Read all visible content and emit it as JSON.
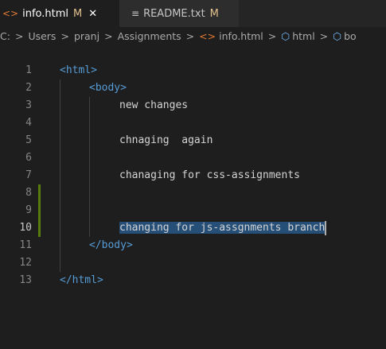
{
  "tabs": [
    {
      "name": "info.html",
      "status": "M",
      "close": "✕",
      "icon": "html-icon",
      "active": true
    },
    {
      "name": "README.txt",
      "status": "M",
      "icon": "text-lines-icon",
      "active": false
    }
  ],
  "breadcrumb": {
    "items": [
      "C:",
      "Users",
      "pranj",
      "Assignments",
      "info.html",
      "html",
      "bo"
    ],
    "separator": ">"
  },
  "editor": {
    "lines": [
      {
        "num": "1",
        "text": "<html>"
      },
      {
        "num": "2",
        "text": "<body>"
      },
      {
        "num": "3",
        "text": "new changes"
      },
      {
        "num": "4",
        "text": ""
      },
      {
        "num": "5",
        "text": "chnaging  again"
      },
      {
        "num": "6",
        "text": ""
      },
      {
        "num": "7",
        "text": "chanaging for css-assignments"
      },
      {
        "num": "8",
        "text": ""
      },
      {
        "num": "9",
        "text": ""
      },
      {
        "num": "10",
        "text": "changing for js-assgnments branch"
      },
      {
        "num": "11",
        "text": "</body>"
      },
      {
        "num": "12",
        "text": ""
      },
      {
        "num": "13",
        "text": "</html>"
      }
    ],
    "current_line": "10"
  },
  "colors": {
    "background": "#1e1e1e",
    "tag": "#569cd6",
    "modified": "#e2c08d",
    "selection": "#264f78",
    "added_bar": "#587c0c",
    "html_icon": "#e37933"
  }
}
